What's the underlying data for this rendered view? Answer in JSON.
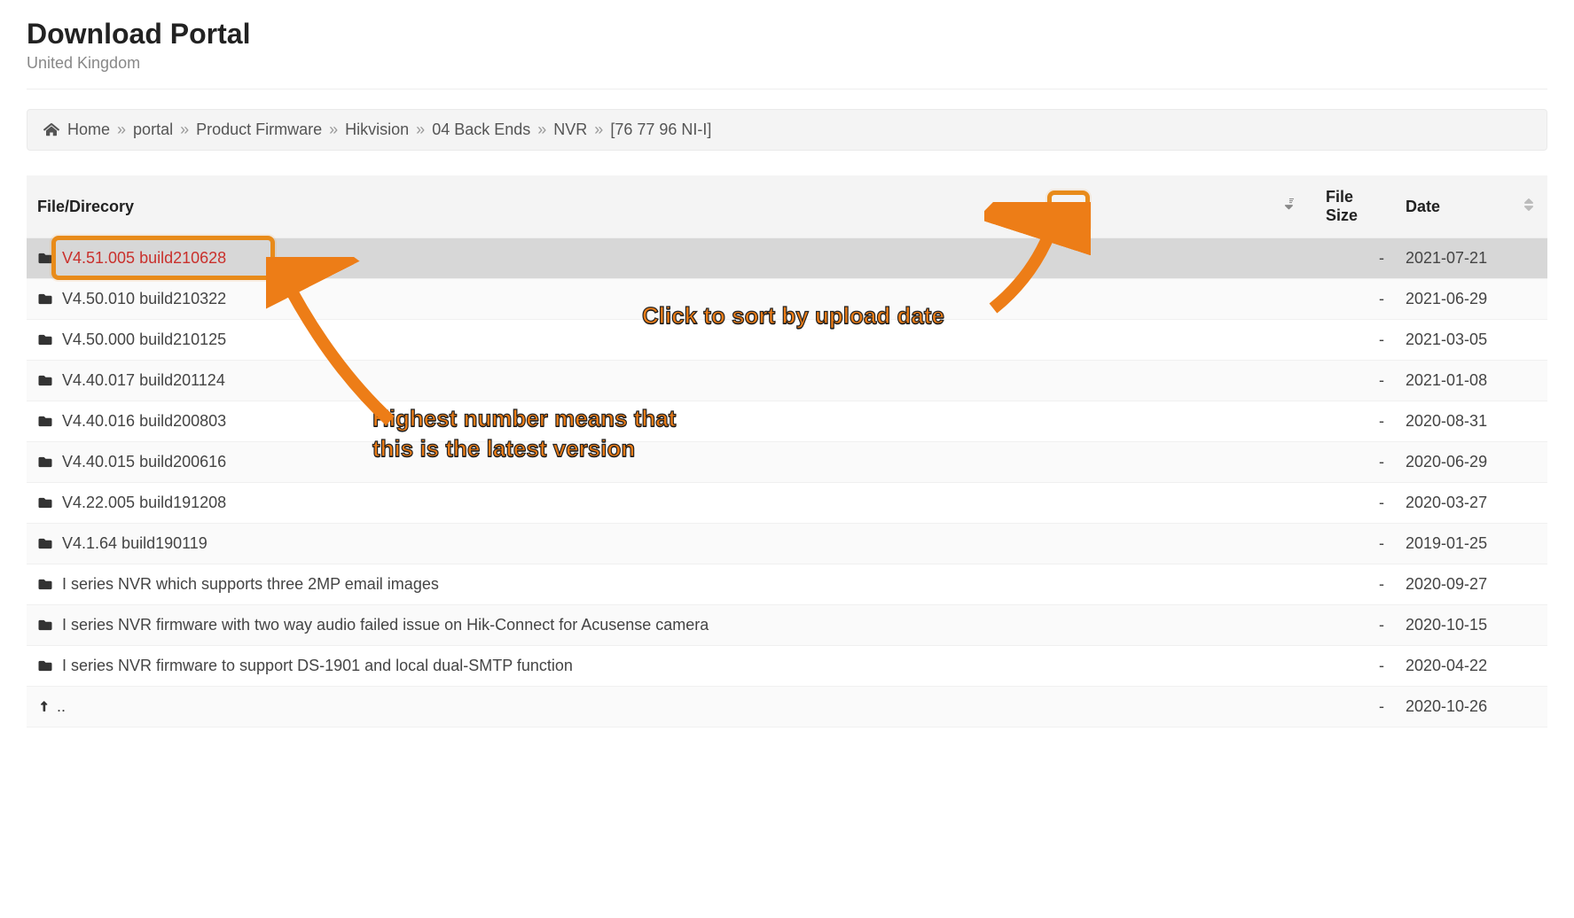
{
  "header": {
    "title": "Download Portal",
    "subtitle": "United Kingdom"
  },
  "breadcrumb": {
    "home": "Home",
    "items": [
      "portal",
      "Product Firmware",
      "Hikvision",
      "04 Back Ends",
      "NVR",
      "[76 77 96 NI-I]"
    ]
  },
  "table": {
    "columns": {
      "file": "File/Direcory",
      "size": "File Size",
      "date": "Date"
    },
    "rows": [
      {
        "name": "V4.51.005 build210628",
        "size": "-",
        "date": "2021-07-21",
        "highlight": true,
        "red": true,
        "up": false
      },
      {
        "name": "V4.50.010 build210322",
        "size": "-",
        "date": "2021-06-29",
        "highlight": false,
        "red": false,
        "up": false
      },
      {
        "name": "V4.50.000 build210125",
        "size": "-",
        "date": "2021-03-05",
        "highlight": false,
        "red": false,
        "up": false
      },
      {
        "name": "V4.40.017 build201124",
        "size": "-",
        "date": "2021-01-08",
        "highlight": false,
        "red": false,
        "up": false
      },
      {
        "name": "V4.40.016 build200803",
        "size": "-",
        "date": "2020-08-31",
        "highlight": false,
        "red": false,
        "up": false
      },
      {
        "name": "V4.40.015 build200616",
        "size": "-",
        "date": "2020-06-29",
        "highlight": false,
        "red": false,
        "up": false
      },
      {
        "name": "V4.22.005 build191208",
        "size": "-",
        "date": "2020-03-27",
        "highlight": false,
        "red": false,
        "up": false
      },
      {
        "name": "V4.1.64 build190119",
        "size": "-",
        "date": "2019-01-25",
        "highlight": false,
        "red": false,
        "up": false
      },
      {
        "name": "I series NVR which supports three 2MP email images",
        "size": "-",
        "date": "2020-09-27",
        "highlight": false,
        "red": false,
        "up": false
      },
      {
        "name": "I series NVR firmware with two way audio failed issue on Hik-Connect for Acusense camera",
        "size": "-",
        "date": "2020-10-15",
        "highlight": false,
        "red": false,
        "up": false
      },
      {
        "name": "I series NVR firmware to support DS-1901 and local dual-SMTP function",
        "size": "-",
        "date": "2020-04-22",
        "highlight": false,
        "red": false,
        "up": false
      },
      {
        "name": "..",
        "size": "-",
        "date": "2020-10-26",
        "highlight": false,
        "red": false,
        "up": true
      }
    ]
  },
  "annotations": {
    "sort": "Click to sort by upload date",
    "latest_l1": "Highest number means that",
    "latest_l2": "this is the latest version"
  }
}
